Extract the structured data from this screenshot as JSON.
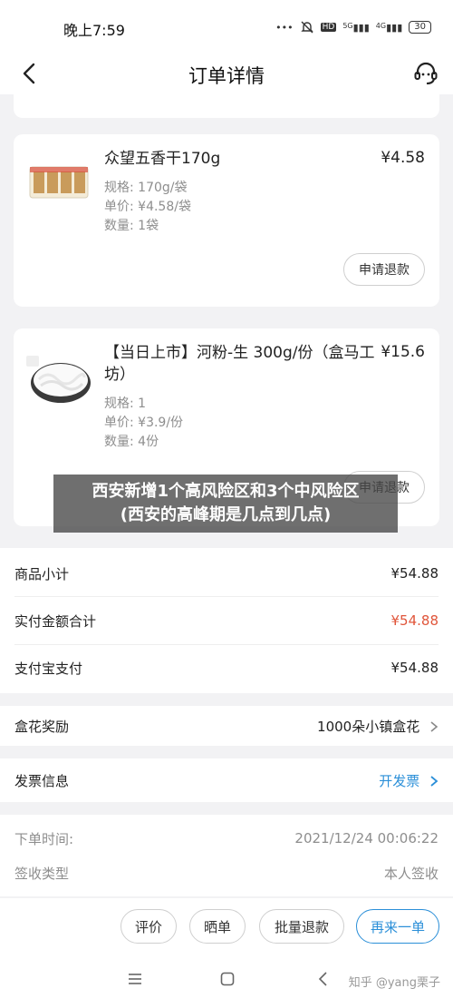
{
  "status_bar": {
    "time": "晚上7:59",
    "signal_tag_1": "5G",
    "signal_tag_2": "4G",
    "battery": "30"
  },
  "nav": {
    "title": "订单详情"
  },
  "products": [
    {
      "name": "众望五香干170g",
      "price": "¥4.58",
      "spec": "规格: 170g/袋",
      "unit_price": "单价: ¥4.58/袋",
      "quantity": "数量: 1袋",
      "refund_label": "申请退款"
    },
    {
      "name_line1": "【当日上市】河粉-生 300g/份（盒马工",
      "name_line2": "坊）",
      "price": "¥15.6",
      "spec": "规格: 1",
      "unit_price": "单价: ¥3.9/份",
      "quantity": "数量: 4份",
      "refund_label": "申请退款"
    }
  ],
  "overlay": {
    "line1": "西安新增1个高风险区和3个中风险区",
    "line2": "(西安的高峰期是几点到几点)"
  },
  "summary": {
    "subtotal_label": "商品小计",
    "subtotal_value": "¥54.88",
    "paid_label": "实付金额合计",
    "paid_value": "¥54.88",
    "alipay_label": "支付宝支付",
    "alipay_value": "¥54.88"
  },
  "reward": {
    "label": "盒花奖励",
    "value": "1000朵小镇盒花"
  },
  "invoice": {
    "label": "发票信息",
    "action": "开发票"
  },
  "order_info": {
    "time_label": "下单时间:",
    "time_value": "2021/12/24 00:06:22",
    "receipt_label": "签收类型",
    "receipt_value": "本人签收"
  },
  "actions": {
    "review": "评价",
    "share": "晒单",
    "batch_refund": "批量退款",
    "reorder": "再来一单"
  },
  "credit": "知乎 @yang栗子",
  "colors": {
    "accent_red": "#e0553a",
    "link_blue": "#2b8fd8"
  }
}
